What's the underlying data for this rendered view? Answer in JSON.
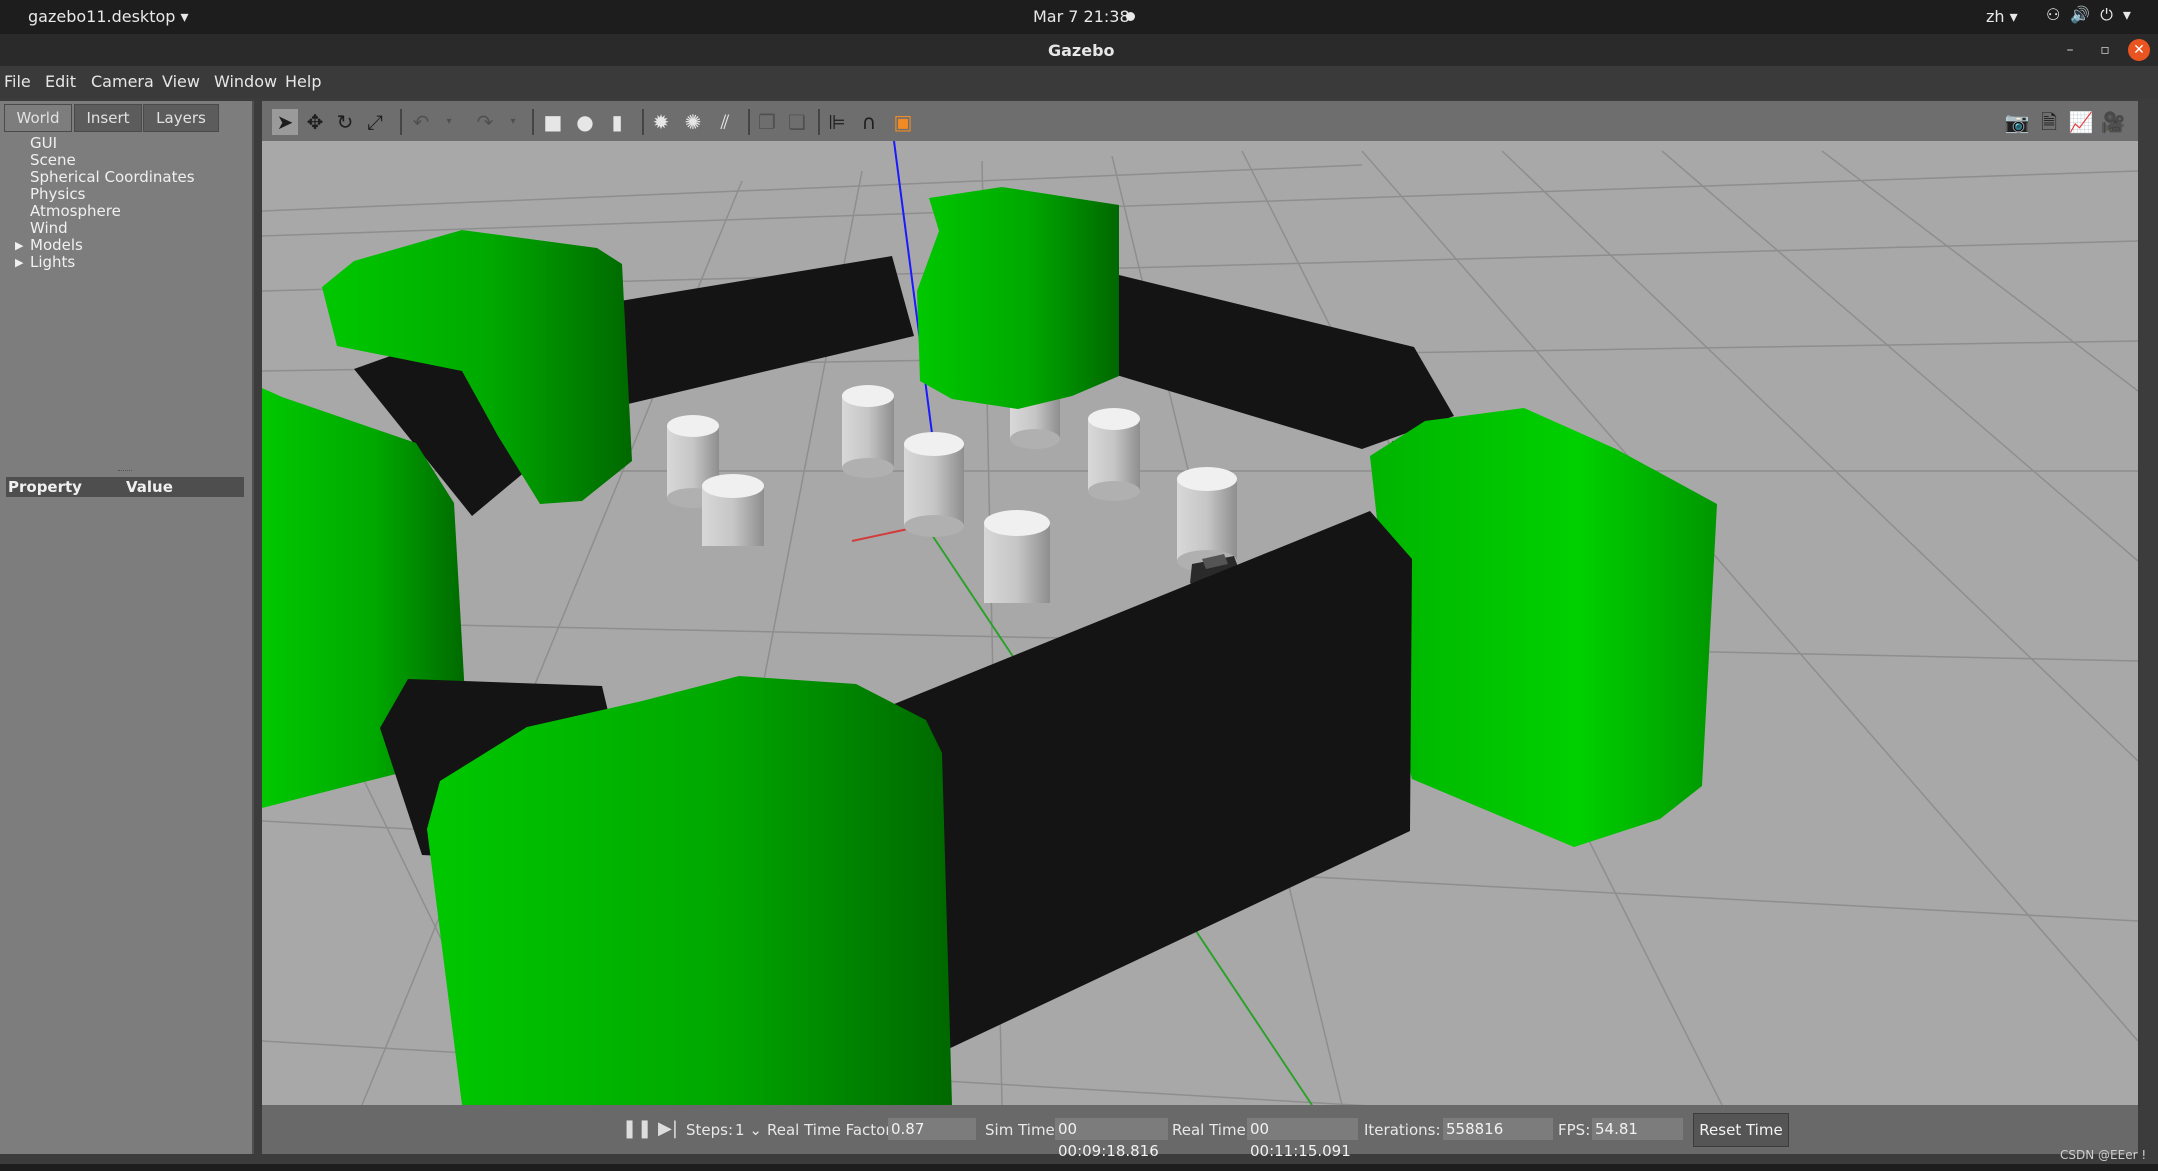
{
  "topbar": {
    "app_menu": "gazebo11.desktop",
    "clock": "Mar 7  21:38",
    "language": "zh"
  },
  "window": {
    "title": "Gazebo"
  },
  "menu": [
    "File",
    "Edit",
    "Camera",
    "View",
    "Window",
    "Help"
  ],
  "left_panel": {
    "tabs": [
      "World",
      "Insert",
      "Layers"
    ],
    "active_tab": "World",
    "tree": [
      "GUI",
      "Scene",
      "Spherical Coordinates",
      "Physics",
      "Atmosphere",
      "Wind",
      "Models",
      "Lights"
    ],
    "expandable": [
      "Models",
      "Lights"
    ],
    "property_header": {
      "property": "Property",
      "value": "Value"
    }
  },
  "toolbar": {
    "left_tools": [
      "select-arrow-icon",
      "translate-icon",
      "rotate-icon",
      "scale-icon",
      "undo-icon",
      "undo-dropdown-icon",
      "redo-icon",
      "redo-dropdown-icon",
      "box-shape-icon",
      "sphere-shape-icon",
      "cylinder-shape-icon",
      "point-light-icon",
      "spot-light-icon",
      "directional-light-icon",
      "copy-icon",
      "paste-icon",
      "align-icon",
      "snap-icon",
      "view-angle-icon"
    ],
    "right_tools": [
      "screenshot-icon",
      "log-icon",
      "plot-icon",
      "record-video-icon"
    ]
  },
  "scene": {
    "colors": {
      "ground": "#a8a8a8",
      "grid": "#8e8e8e",
      "wall": "#141414",
      "green": "#00c000",
      "cylinder": "#dcdcdc",
      "z_axis": "#1a1aff",
      "x_axis": "#d23c3c",
      "y_axis": "#2ea02e"
    }
  },
  "status": {
    "steps_label": "Steps:",
    "steps_value": "1",
    "real_time_factor_label": "Real Time Factor:",
    "real_time_factor": "0.87",
    "sim_time_label": "Sim Time:",
    "sim_time": "00 00:09:18.816",
    "real_time_label": "Real Time:",
    "real_time": "00 00:11:15.091",
    "iterations_label": "Iterations:",
    "iterations": "558816",
    "fps_label": "FPS:",
    "fps": "54.81",
    "reset_button": "Reset Time"
  },
  "watermark": "CSDN @EEer !"
}
